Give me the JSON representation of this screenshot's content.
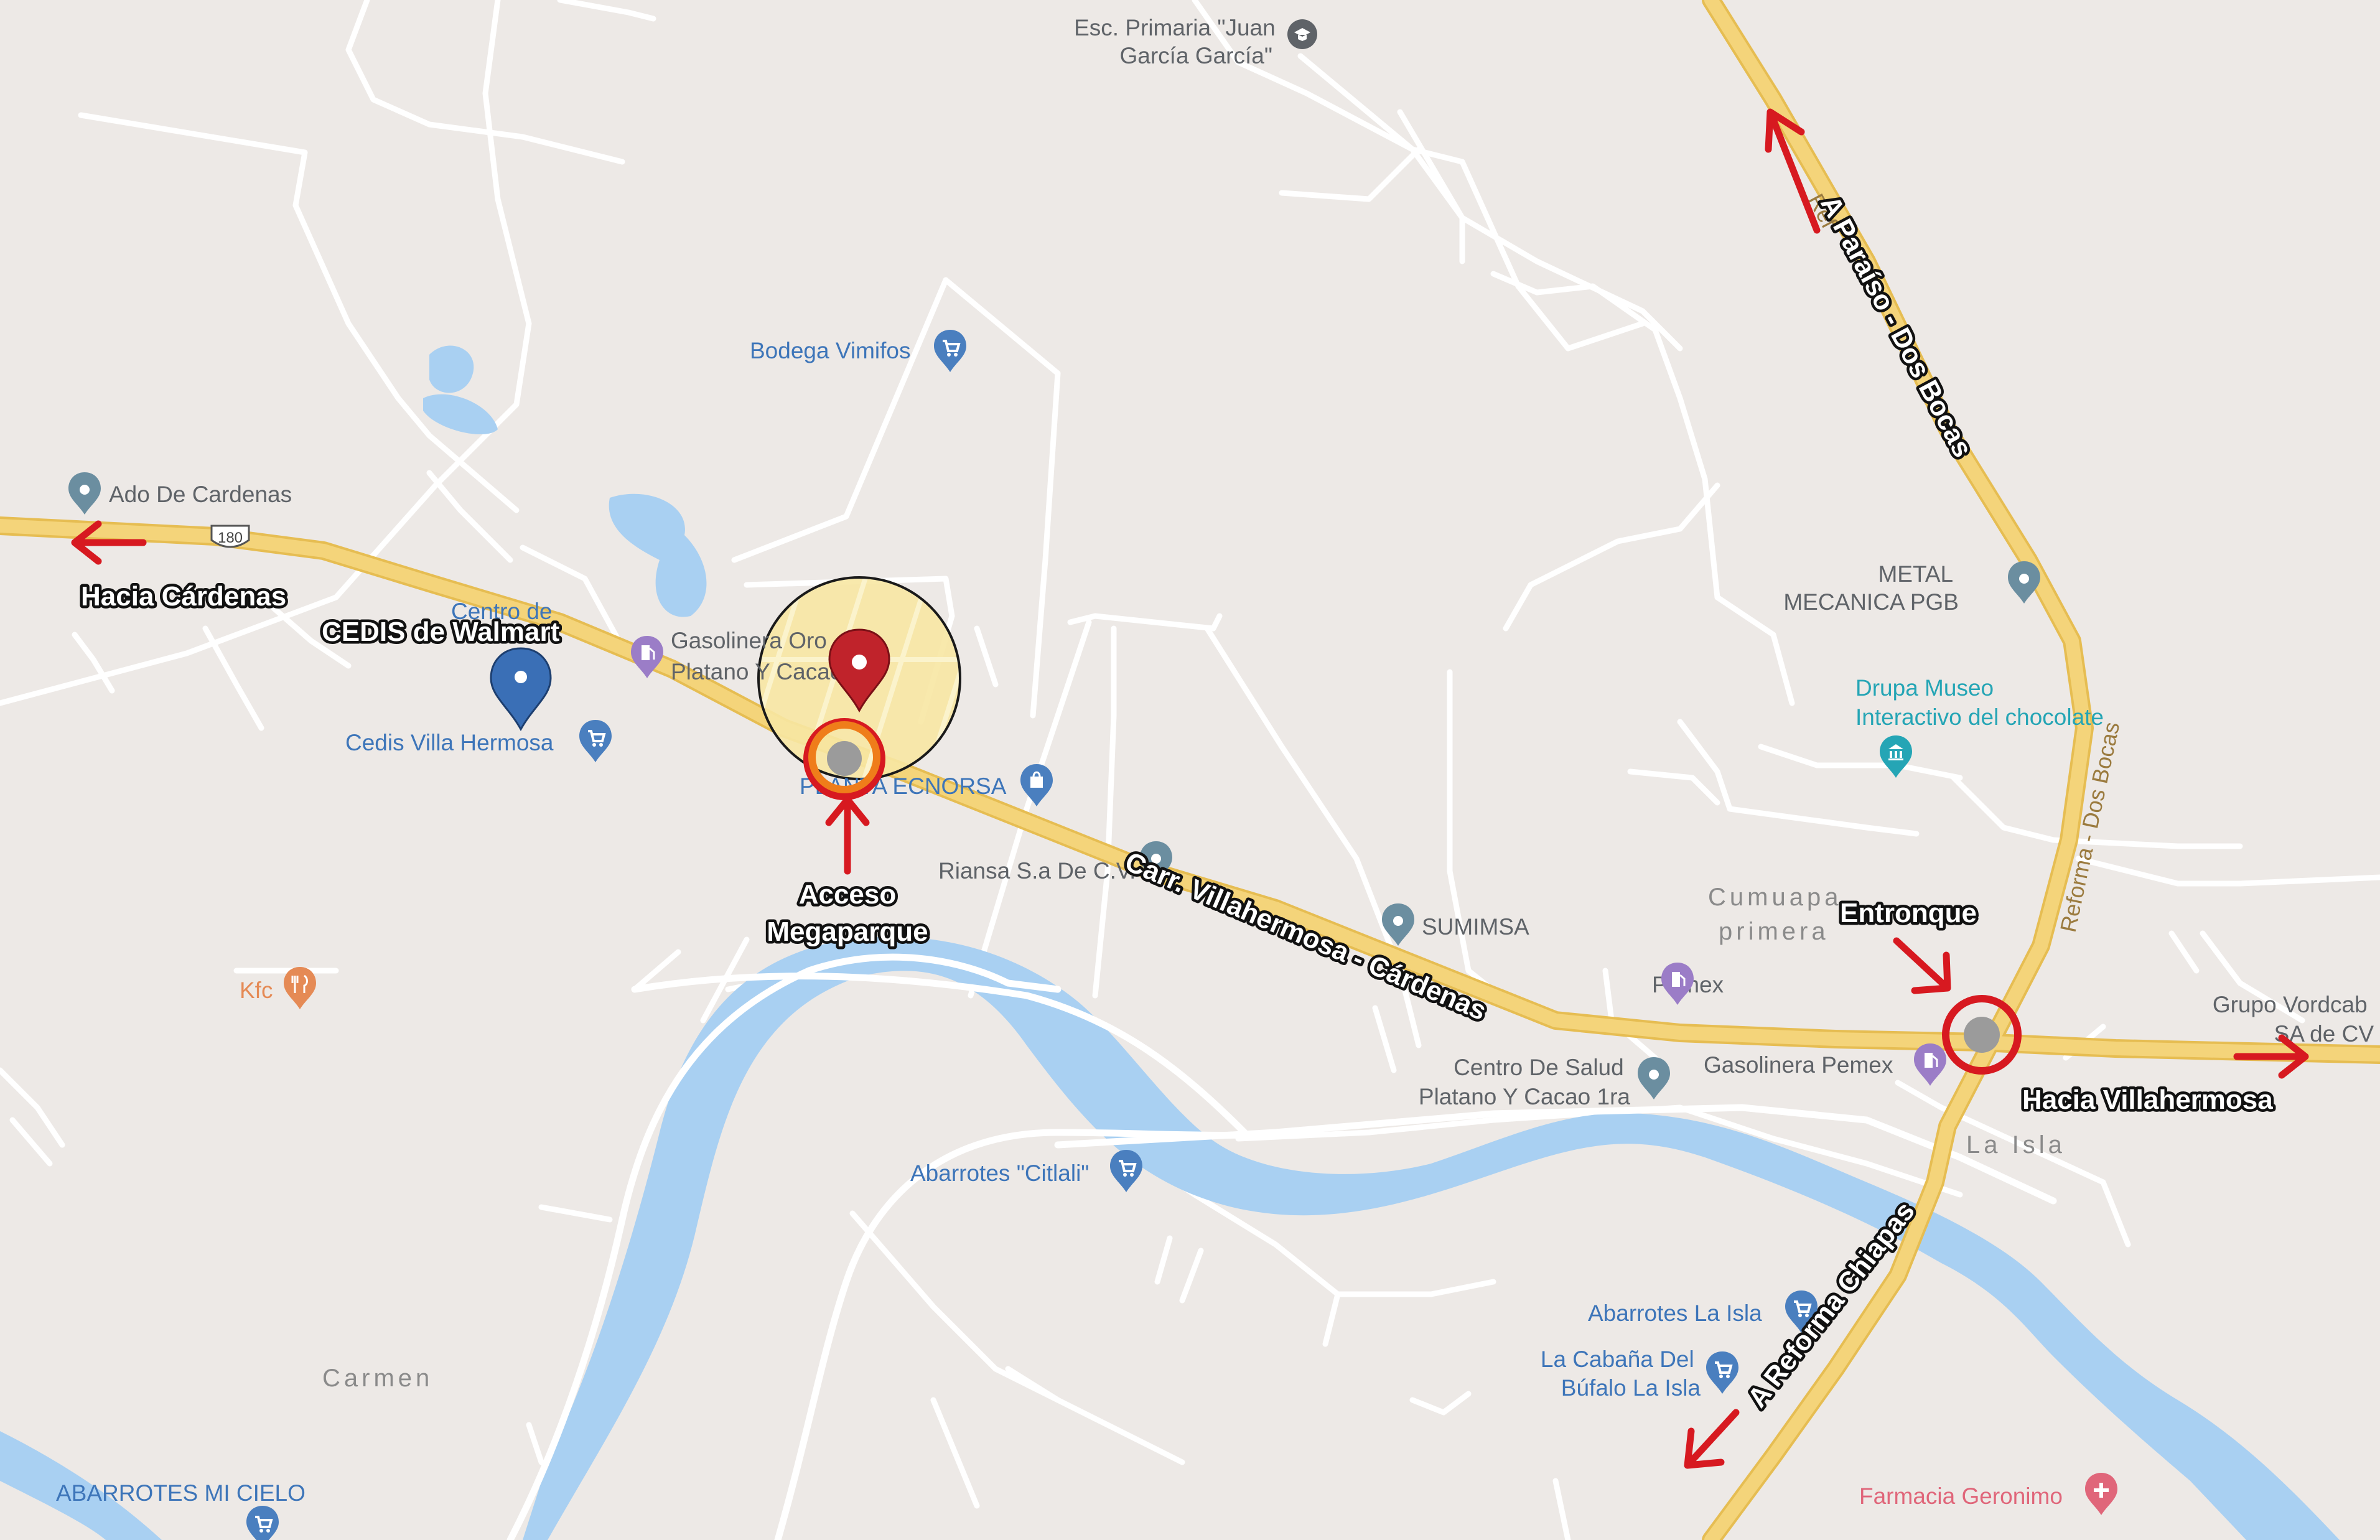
{
  "map": {
    "colors": {
      "land": "#ede9e6",
      "water": "#a9d0f2",
      "highway": "#f4d47a",
      "highway_edge": "#e6bd52",
      "minor_road": "#ffffff",
      "annotation_red": "#d71920",
      "annotation_orange": "#ef7d1a",
      "site_fill": "#f7e7a3",
      "poi_blue": "#4a7fbf",
      "poi_teal": "#25a5b5",
      "poi_purple": "#9b7dc7",
      "poi_orange": "#e58a55",
      "poi_pink": "#e0667a",
      "poi_label_blue": "#3d75b9",
      "poi_label_gray": "#5f6368"
    },
    "shield": {
      "number": "180"
    },
    "road_labels": {
      "main_road": "Carr. Villahermosa - Cárdenas",
      "north_road": "A Paraíso - Dos Bocas",
      "south_road": "A Reforma Chiapas",
      "north_road_map_label": "Reforma - Dos Bocas",
      "north_road_map_label_top": "Ref"
    },
    "annotations": {
      "to_cardenas": "Hacia Cárdenas",
      "to_villahermosa": "Hacia Villahermosa",
      "cedis": "CEDIS de Walmart",
      "access_line1": "Acceso",
      "access_line2": "Megaparque",
      "junction": "Entronque"
    },
    "places": {
      "cumuapa_line1": "Cumuapa",
      "cumuapa_line2": "primera",
      "la_isla": "La Isla",
      "carmen": "Carmen"
    },
    "pois": [
      {
        "id": "esc-primaria",
        "lines": [
          "Esc. Primaria \"Juan",
          "García García\""
        ],
        "icon": "school-icon",
        "color": "#5f6368"
      },
      {
        "id": "bodega-vimifos",
        "lines": [
          "Bodega Vimifos"
        ],
        "icon": "shopping-cart-icon",
        "color": "#3d75b9"
      },
      {
        "id": "ado-cardenas",
        "lines": [
          "Ado De Cardenas"
        ],
        "icon": "place-icon",
        "color": "#5f6368"
      },
      {
        "id": "centro-de",
        "lines": [
          "Centro de"
        ],
        "icon": "",
        "color": "#3d75b9"
      },
      {
        "id": "gasolinera-platano",
        "lines": [
          "Gasolinera Oro",
          "Platano Y Cacao"
        ],
        "icon": "gas-station-icon",
        "color": "#5f6368"
      },
      {
        "id": "cedis-villahermosa",
        "lines": [
          "Cedis Villa Hermosa"
        ],
        "icon": "shopping-cart-icon",
        "color": "#3d75b9"
      },
      {
        "id": "planta-ecnorsa",
        "lines": [
          "PLANTA ECNORSA"
        ],
        "icon": "shopping-bag-icon",
        "color": "#3d75b9"
      },
      {
        "id": "riansa",
        "lines": [
          "Riansa S.a De C.V."
        ],
        "icon": "place-icon",
        "color": "#5f6368"
      },
      {
        "id": "sumimsa",
        "lines": [
          "SUMIMSA"
        ],
        "icon": "place-icon",
        "color": "#5f6368"
      },
      {
        "id": "metal-mecanica",
        "lines": [
          "METAL",
          "MECANICA PGB"
        ],
        "icon": "place-icon",
        "color": "#5f6368"
      },
      {
        "id": "drupa-museo",
        "lines": [
          "Drupa Museo",
          "Interactivo del chocolate"
        ],
        "icon": "museum-icon",
        "color": "#25a5b5"
      },
      {
        "id": "grupo-vordcab",
        "lines": [
          "Grupo Vordcab",
          "SA de CV"
        ],
        "icon": "",
        "color": "#5f6368"
      },
      {
        "id": "pemex",
        "lines": [
          "Pemex"
        ],
        "icon": "gas-station-icon",
        "color": "#5f6368"
      },
      {
        "id": "gasolinera-pemex",
        "lines": [
          "Gasolinera Pemex"
        ],
        "icon": "gas-station-icon",
        "color": "#5f6368"
      },
      {
        "id": "centro-salud",
        "lines": [
          "Centro De Salud",
          "Platano Y Cacao 1ra"
        ],
        "icon": "place-icon",
        "color": "#5f6368"
      },
      {
        "id": "kfc",
        "lines": [
          "Kfc"
        ],
        "icon": "restaurant-icon",
        "color": "#e58a55"
      },
      {
        "id": "abarrotes-citlali",
        "lines": [
          "Abarrotes \"Citlali\""
        ],
        "icon": "shopping-cart-icon",
        "color": "#3d75b9"
      },
      {
        "id": "abarrotes-la-isla",
        "lines": [
          "Abarrotes La Isla"
        ],
        "icon": "shopping-cart-icon",
        "color": "#3d75b9"
      },
      {
        "id": "cabana-bufalo",
        "lines": [
          "La Cabaña Del",
          "Búfalo La Isla"
        ],
        "icon": "shopping-cart-icon",
        "color": "#3d75b9"
      },
      {
        "id": "abarrotes-mi-cielo",
        "lines": [
          "ABARROTES MI CIELO"
        ],
        "icon": "shopping-cart-icon",
        "color": "#3d75b9"
      },
      {
        "id": "farmacia-geronimo",
        "lines": [
          "Farmacia Geronimo"
        ],
        "icon": "pharmacy-icon",
        "color": "#e0667a"
      }
    ]
  }
}
